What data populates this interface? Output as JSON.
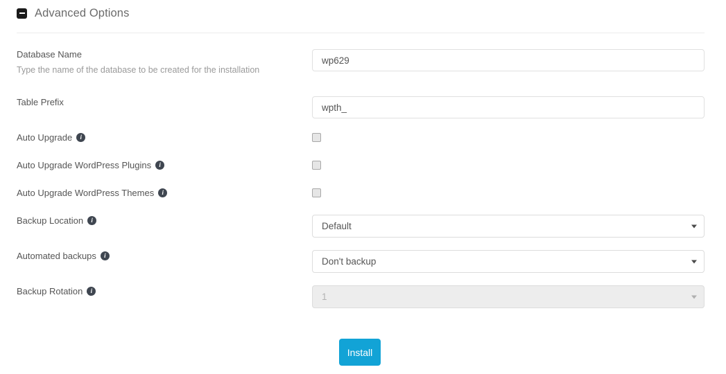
{
  "panel": {
    "title": "Advanced Options",
    "collapse_icon": "minus-square-icon"
  },
  "fields": {
    "database_name": {
      "label": "Database Name",
      "description": "Type the name of the database to be created for the installation",
      "value": "wp629",
      "placeholder": ""
    },
    "table_prefix": {
      "label": "Table Prefix",
      "value": "wpth_",
      "placeholder": ""
    },
    "auto_upgrade": {
      "label": "Auto Upgrade",
      "info": "i",
      "checked": false
    },
    "auto_upgrade_plugins": {
      "label": "Auto Upgrade WordPress Plugins",
      "info": "i",
      "checked": false
    },
    "auto_upgrade_themes": {
      "label": "Auto Upgrade WordPress Themes",
      "info": "i",
      "checked": false
    },
    "backup_location": {
      "label": "Backup Location",
      "info": "i",
      "selected": "Default"
    },
    "automated_backups": {
      "label": "Automated backups",
      "info": "i",
      "selected": "Don't backup"
    },
    "backup_rotation": {
      "label": "Backup Rotation",
      "info": "i",
      "selected": "1",
      "disabled": true
    }
  },
  "actions": {
    "install_label": "Install"
  },
  "colors": {
    "accent": "#12a3d6",
    "label_text": "#555555",
    "description_text": "#9a9a9a",
    "border": "#e0e0e0",
    "disabled_bg": "#ededed"
  }
}
